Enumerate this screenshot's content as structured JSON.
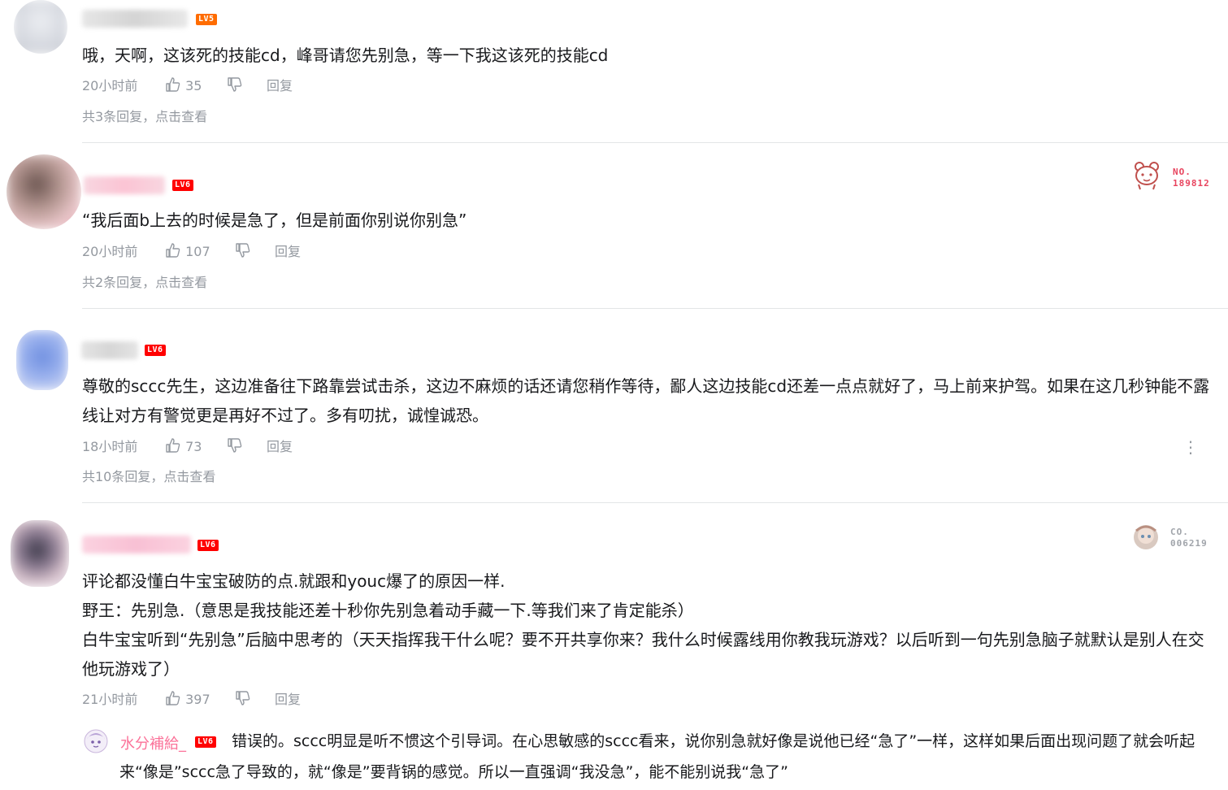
{
  "comments": [
    {
      "level": "LV5",
      "content": "哦，天啊，这该死的技能cd，峰哥请您先别急，等一下我这该死的技能cd",
      "time": "20小时前",
      "likes": "35",
      "reply_label": "回复",
      "replies_link": "共3条回复，点击查看"
    },
    {
      "level": "LV6",
      "content": "“我后面b上去的时候是急了，但是前面你别说你别急”",
      "time": "20小时前",
      "likes": "107",
      "reply_label": "回复",
      "replies_link": "共2条回复，点击查看",
      "badge_label": "NO.",
      "badge_number": "189812"
    },
    {
      "level": "LV6",
      "content": "尊敬的sccc先生，这边准备往下路靠尝试击杀，这边不麻烦的话还请您稍作等待，鄙人这边技能cd还差一点点就好了，马上前来护驾。如果在这几秒钟能不露线让对方有警觉更是再好不过了。多有叨扰，诚惶诚恐。",
      "time": "18小时前",
      "likes": "73",
      "reply_label": "回复",
      "replies_link": "共10条回复，点击查看",
      "more_icon": "⋮"
    },
    {
      "level": "LV6",
      "content_lines": [
        "评论都没懂白牛宝宝破防的点.就跟和youc爆了的原因一样.",
        "野王：先别急.（意思是我技能还差十秒你先别急着动手藏一下.等我们来了肯定能杀）",
        "白牛宝宝听到“先别急”后脑中思考的（天天指挥我干什么呢？要不开共享你来？我什么时候露线用你教我玩游戏？以后听到一句先别急脑子就默认是别人在交他玩游戏了）"
      ],
      "time": "21小时前",
      "likes": "397",
      "reply_label": "回复",
      "badge_label": "CO.",
      "badge_number": "006219",
      "sub_reply": {
        "username": "水分補給_",
        "level": "LV6",
        "content": "错误的。sccc明显是听不惯这个引导词。在心思敏感的sccc看来，说你别急就好像是说他已经“急了”一样，这样如果后面出现问题了就会听起来“像是”sccc急了导致的，就“像是”要背锅的感觉。所以一直强调“我没急”，能不能别说我“急了”"
      }
    }
  ],
  "colors": {
    "lv5": "#ff6c00",
    "lv6": "#ff0000",
    "meta_gray": "#9499a0",
    "username_pink": "#fb7299"
  },
  "icons": [
    "like-icon",
    "dislike-icon",
    "more-icon",
    "fan-badge-icon"
  ]
}
